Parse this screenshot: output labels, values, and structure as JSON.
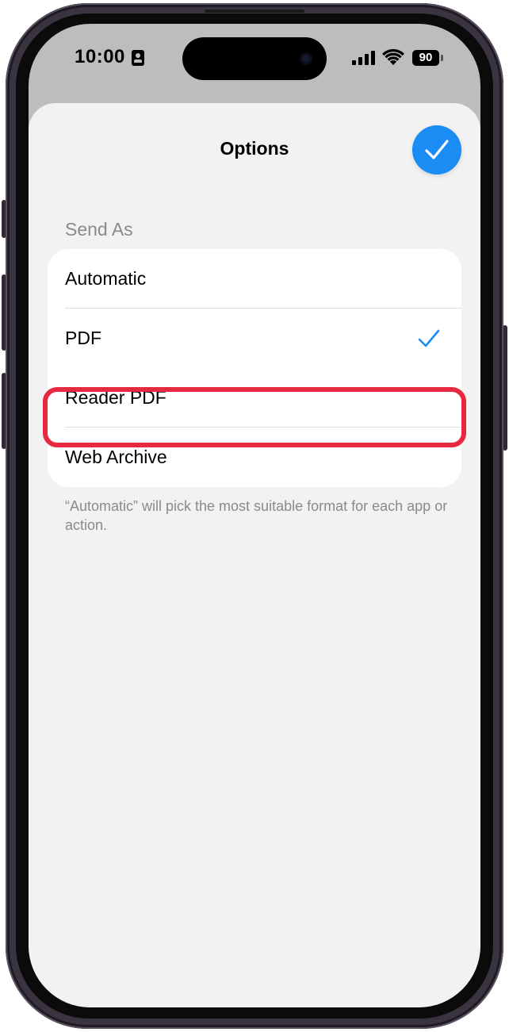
{
  "status_bar": {
    "time": "10:00",
    "battery": "90",
    "icons": [
      "focus-contact-icon",
      "cellular-signal-icon",
      "wifi-icon",
      "battery-icon"
    ]
  },
  "sheet": {
    "title": "Options",
    "done_icon": "checkmark-icon"
  },
  "send_as": {
    "header": "Send As",
    "options": [
      {
        "label": "Automatic",
        "selected": false
      },
      {
        "label": "PDF",
        "selected": true
      },
      {
        "label": "Reader PDF",
        "selected": false
      },
      {
        "label": "Web Archive",
        "selected": false
      }
    ],
    "footer": "“Automatic” will pick the most suitable format for each app or action."
  },
  "colors": {
    "accent": "#1a8cf4",
    "highlight": "#e8283f",
    "sheet_background": "#f2f2f2",
    "secondary_text": "#8a8a8e"
  }
}
